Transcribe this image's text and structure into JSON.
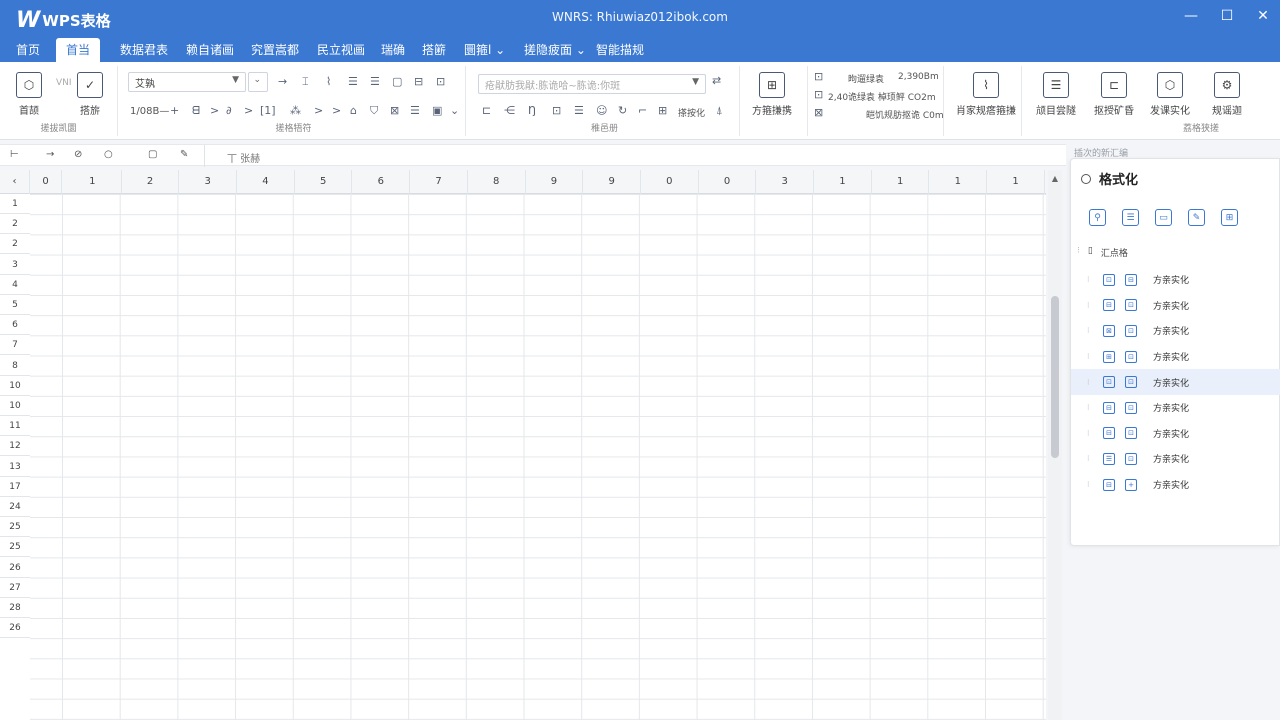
{
  "app": {
    "logo_letter": "W",
    "logo_text": "WPS表格",
    "window_title": "WNRS: Rhiuwiaz012ibok.com",
    "controls": [
      "—",
      "☐",
      "✕"
    ]
  },
  "menu": {
    "tabs": [
      "首页",
      "首当",
      "数据君表",
      "赖自诸画",
      "究置嵩都",
      "民立视画",
      "瑞确",
      "搭簖",
      "圜箍l ⌄",
      "搓隐疲面 ⌄",
      "智能描规"
    ]
  },
  "ribbon": {
    "group1": {
      "btn1": "首颉",
      "btn2": "搭旂",
      "small": "VNI",
      "label": "搓拔凯圜"
    },
    "group2": {
      "font_value": "艾孰",
      "font_size": "1/08B—",
      "label": "搓格牾符"
    },
    "group3": {
      "input_placeholder": "疮猒肪我猒:胨诡哈~胨诡:你斑",
      "btn": "搽按化",
      "label": "稚邑册"
    },
    "group4": {
      "btn": "方箍搛携"
    },
    "group5": {
      "line1_label": "昫遛绿袁",
      "line1_val": "2,390Bm",
      "line2": "2,40诡绿袁 棹顼鲆 CO2m",
      "line3": "皑饥规肪抠诡 C0m"
    },
    "group6": {
      "btn": "肖家规瘩箍搛"
    },
    "group7": {
      "btn1": "颃目尝隧",
      "btn2": "抠授矿昏",
      "btn3": "发课实化",
      "btn4": "规谣迦",
      "label": "荔格狭搓"
    }
  },
  "formula_bar": {
    "cell_ref": "丅",
    "content": "丅 张赫"
  },
  "grid": {
    "columns": [
      "0",
      "1",
      "2",
      "3",
      "4",
      "5",
      "6",
      "7",
      "8",
      "9",
      "9",
      "0",
      "0",
      "3",
      "1",
      "1",
      "1",
      "1"
    ],
    "rows": [
      "1",
      "2",
      "2",
      "3",
      "4",
      "5",
      "6",
      "7",
      "8",
      "10",
      "10",
      "11",
      "12",
      "13",
      "17",
      "24",
      "25",
      "25",
      "26",
      "27",
      "28",
      "26"
    ]
  },
  "panel": {
    "caption": "插次的新汇编",
    "title": "格式化",
    "root_label": "汇点格",
    "items": [
      {
        "label": "方亲实化",
        "selected": false
      },
      {
        "label": "方亲实化",
        "selected": false
      },
      {
        "label": "方亲实化",
        "selected": false
      },
      {
        "label": "方亲实化",
        "selected": false
      },
      {
        "label": "方亲实化",
        "selected": true
      },
      {
        "label": "方亲实化",
        "selected": false
      },
      {
        "label": "方亲实化",
        "selected": false
      },
      {
        "label": "方亲实化",
        "selected": false
      },
      {
        "label": "方亲实化",
        "selected": false
      }
    ]
  },
  "colors": {
    "brand": "#3a78d2",
    "selection": "#eaf0fb"
  }
}
